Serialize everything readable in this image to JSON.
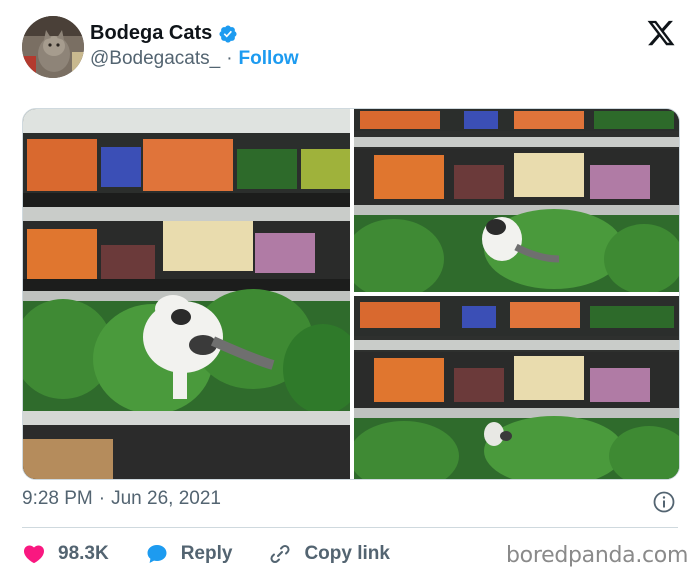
{
  "author": {
    "name": "Bodega Cats",
    "handle": "@Bodegacats_",
    "separator": "·",
    "follow_label": "Follow",
    "verified": true
  },
  "brand_icon": "x-logo-icon",
  "media": {
    "photos": [
      {
        "subject": "cat-on-produce-shelf-close"
      },
      {
        "subject": "cat-on-produce-shelf-wide"
      },
      {
        "subject": "cat-on-produce-shelf-far"
      }
    ]
  },
  "timestamp": {
    "time": "9:28 PM",
    "separator": "·",
    "date": "Jun 26, 2021"
  },
  "actions": {
    "likes": "98.3K",
    "reply_label": "Reply",
    "copy_link_label": "Copy link"
  },
  "watermark": "boredpanda.com",
  "colors": {
    "accent": "#1d9bf0",
    "like": "#f91880",
    "text": "#0f1419",
    "muted": "#536471",
    "border": "#cfd9de"
  }
}
